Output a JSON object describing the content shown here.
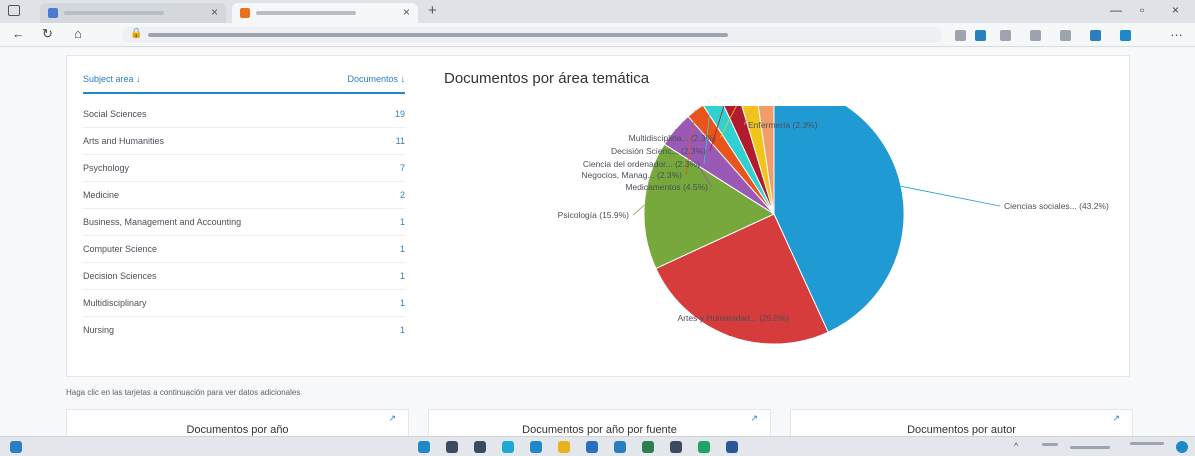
{
  "table": {
    "header": {
      "subject": "Subject area ↓",
      "documents": "Documentos ↓"
    },
    "rows": [
      {
        "name": "Social Sciences",
        "count": "19"
      },
      {
        "name": "Arts and Humanities",
        "count": "11"
      },
      {
        "name": "Psychology",
        "count": "7"
      },
      {
        "name": "Medicine",
        "count": "2"
      },
      {
        "name": "Business, Management and Accounting",
        "count": "1"
      },
      {
        "name": "Computer Science",
        "count": "1"
      },
      {
        "name": "Decision Sciences",
        "count": "1"
      },
      {
        "name": "Multidisciplinary",
        "count": "1"
      },
      {
        "name": "Nursing",
        "count": "1"
      }
    ]
  },
  "chart_title": "Documentos por área temática",
  "chart_data": {
    "type": "pie",
    "slices": [
      {
        "label": "Ciencias sociales... (43.2%)",
        "value": 43.2,
        "color": "#1f9ad3"
      },
      {
        "label": "Artes y Humanidad... (25.0%)",
        "value": 25.0,
        "color": "#d63c3c"
      },
      {
        "label": "Psicología (15.9%)",
        "value": 15.9,
        "color": "#76a83c"
      },
      {
        "label": "Medicamentos (4.5%)",
        "value": 4.5,
        "color": "#9b59b6"
      },
      {
        "label": "Negocios, Manag... (2.3%)",
        "value": 2.3,
        "color": "#e9541a"
      },
      {
        "label": "Ciencia del ordenador... (2.3%)",
        "value": 2.3,
        "color": "#2fd1d1"
      },
      {
        "label": "Decisión Scienc... (2.3%)",
        "value": 2.3,
        "color": "#b01c2e"
      },
      {
        "label": "Multidisciplina... (2.3%)",
        "value": 2.3,
        "color": "#f0c419"
      },
      {
        "label": "Enfermería (2.3%)",
        "value": 2.3,
        "color": "#f39c6b"
      }
    ]
  },
  "hint": "Haga clic en las tarjetas a continuación para ver datos adicionales",
  "cards": [
    {
      "title": "Documentos por año",
      "expand": "↗"
    },
    {
      "title": "Documentos por año por fuente",
      "expand": "↗"
    },
    {
      "title": "Documentos por autor",
      "expand": "↗"
    }
  ],
  "browser": {
    "new_tab": "+",
    "close": "×",
    "minimize": "—",
    "maximize": "▫",
    "back": "←",
    "reload": "↻",
    "home": "⌂",
    "more": "…"
  },
  "colors": {
    "accent": "#1e88c9",
    "page_bg": "#f7f8fa",
    "card_bg": "#ffffff"
  }
}
